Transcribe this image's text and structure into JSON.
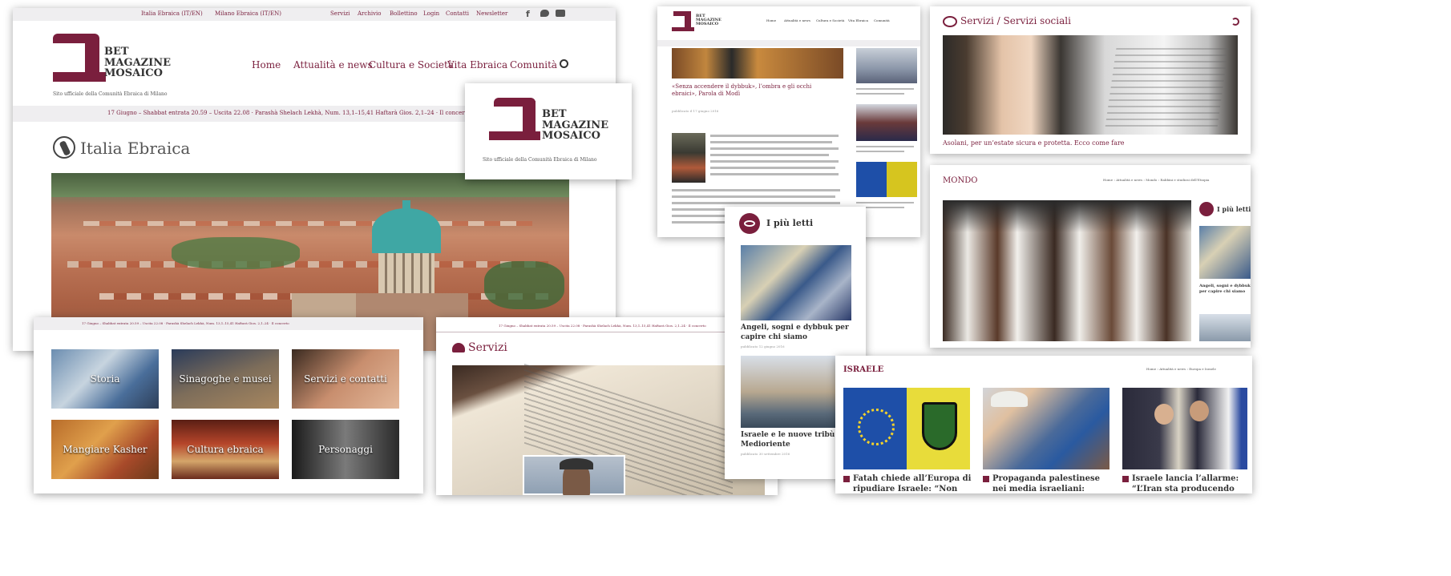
{
  "topbar": {
    "link_it": "Italia Ebraica (IT/EN)",
    "link_mi": "Milano Ebraica (IT/EN)",
    "menu": [
      "Servizi",
      "Archivio",
      "Bollettino",
      "Login",
      "Contatti",
      "Newsletter"
    ],
    "social": [
      "f",
      "t",
      "yt"
    ]
  },
  "logo": {
    "line1": "BET",
    "line2": "MAGAZINE",
    "line3": "MOSAICO",
    "subtitle": "Sito ufficiale della Comunità Ebraica di Milano"
  },
  "nav": [
    "Home",
    "Attualità e news",
    "Cultura e Società",
    "Vita Ebraica",
    "Comunità"
  ],
  "ticker": "17 Giugno – Shabbat entrata 20.59 – Uscita 22.08  ·  Parashà Shelach Lekhà, Num. 13,1–15,41 Haftarà Gios. 2,1–24  ·  Il concerto",
  "page1": {
    "title": "Italia Ebraica"
  },
  "tiles": [
    {
      "label": "Storia"
    },
    {
      "label": "Sinagoghe e musei"
    },
    {
      "label": "Servizi e contatti"
    },
    {
      "label": "Mangiare Kasher"
    },
    {
      "label": "Cultura ebraica"
    },
    {
      "label": "Personaggi"
    }
  ],
  "services": {
    "title": "Servizi"
  },
  "article": {
    "headline": "«Senza accendere il dybbuk», l’ombra e gli occhi ebraici», Parola di Modì",
    "meta": "pubblicato il 17 giugno 2016"
  },
  "most_read": {
    "title": "I più letti",
    "items": [
      {
        "title": "Angeli, sogni e dybbuk per capire chi siamo",
        "date": "pubblicato 12 giugno 2016"
      },
      {
        "title": "Israele e le nuove tribù del Medioriente",
        "date": "pubblicato 30 settembre 2016"
      }
    ]
  },
  "social_services": {
    "title": "Servizi / Servizi sociali",
    "caption": "Asolani, per un’estate sicura e protetta. Ecco come fare"
  },
  "mondo": {
    "title": "MONDO",
    "breadcrumb": "Home › Attualità e news › Mondo › Rabbini e studiosi dell’Etiopia",
    "sidebar_title": "I più letti",
    "sidebar_caption": "Angeli, sogni e dybbuk per capire chi siamo"
  },
  "israele": {
    "title": "ISRAELE",
    "breadcrumb": "Home › Attualità e news › Europa e Israele",
    "items": [
      {
        "title": "Fatah chiede all’Europa di ripudiare Israele: “Non rispetta i"
      },
      {
        "title": "Propaganda palestinese nei media israeliani: Israele"
      },
      {
        "title": "Israele lancia l’allarme: “L’Iran sta producendo armi di"
      }
    ]
  },
  "colors": {
    "accent": "#7a1f3d",
    "bar": "#efeef0"
  }
}
